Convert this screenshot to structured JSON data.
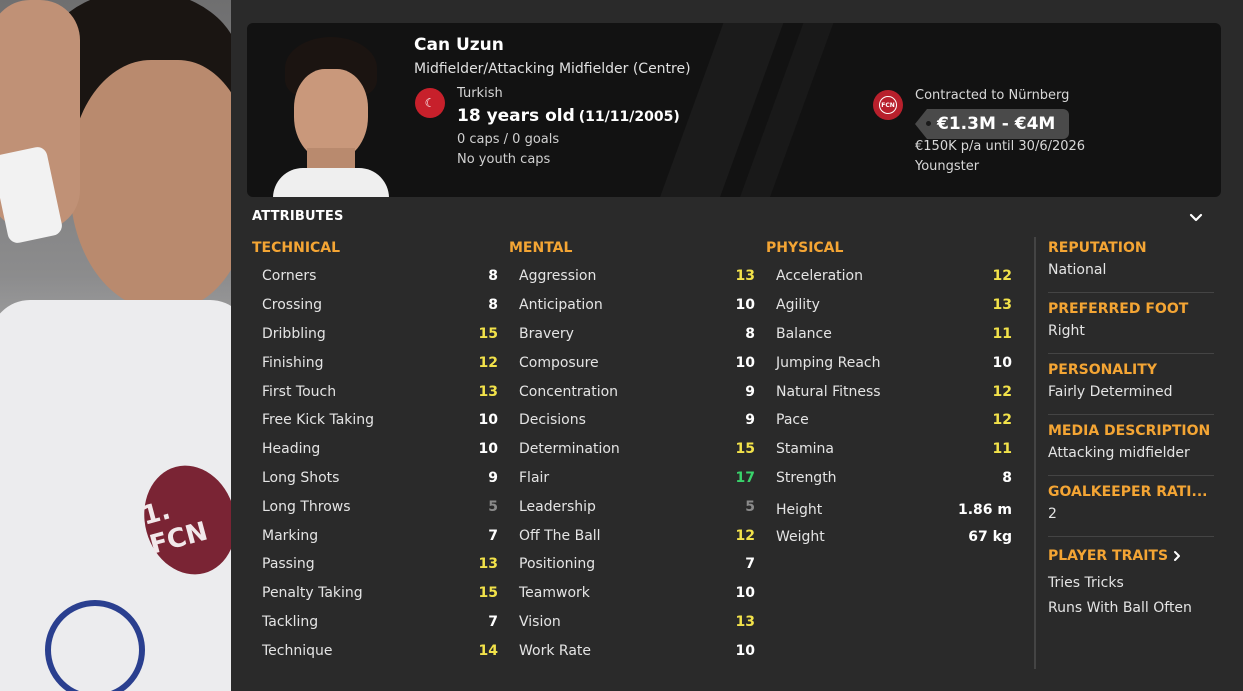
{
  "player": {
    "name": "Can Uzun",
    "position": "Midfielder/Attacking Midfielder (Centre)",
    "nationality": "Turkish",
    "age": "18 years old",
    "dob": "(11/11/2005)",
    "caps": "0 caps / 0 goals",
    "youth_caps": "No youth caps",
    "club_crest_text": "FCN",
    "contract": "Contracted to Nürnberg",
    "value": "€1.3M - €4M",
    "wage": "€150K p/a until 30/6/2026",
    "squad_status": "Youngster",
    "shirt_badge_text": "1. FCN"
  },
  "attributes": {
    "title": "ATTRIBUTES",
    "technical": {
      "heading": "TECHNICAL",
      "items": [
        {
          "label": "Corners",
          "value": "8"
        },
        {
          "label": "Crossing",
          "value": "8"
        },
        {
          "label": "Dribbling",
          "value": "15"
        },
        {
          "label": "Finishing",
          "value": "12"
        },
        {
          "label": "First Touch",
          "value": "13"
        },
        {
          "label": "Free Kick Taking",
          "value": "10"
        },
        {
          "label": "Heading",
          "value": "10"
        },
        {
          "label": "Long Shots",
          "value": "9"
        },
        {
          "label": "Long Throws",
          "value": "5"
        },
        {
          "label": "Marking",
          "value": "7"
        },
        {
          "label": "Passing",
          "value": "13"
        },
        {
          "label": "Penalty Taking",
          "value": "15"
        },
        {
          "label": "Tackling",
          "value": "7"
        },
        {
          "label": "Technique",
          "value": "14"
        }
      ]
    },
    "mental": {
      "heading": "MENTAL",
      "items": [
        {
          "label": "Aggression",
          "value": "13"
        },
        {
          "label": "Anticipation",
          "value": "10"
        },
        {
          "label": "Bravery",
          "value": "8"
        },
        {
          "label": "Composure",
          "value": "10"
        },
        {
          "label": "Concentration",
          "value": "9"
        },
        {
          "label": "Decisions",
          "value": "9"
        },
        {
          "label": "Determination",
          "value": "15"
        },
        {
          "label": "Flair",
          "value": "17"
        },
        {
          "label": "Leadership",
          "value": "5"
        },
        {
          "label": "Off The Ball",
          "value": "12"
        },
        {
          "label": "Positioning",
          "value": "7"
        },
        {
          "label": "Teamwork",
          "value": "10"
        },
        {
          "label": "Vision",
          "value": "13"
        },
        {
          "label": "Work Rate",
          "value": "10"
        }
      ]
    },
    "physical": {
      "heading": "PHYSICAL",
      "items": [
        {
          "label": "Acceleration",
          "value": "12"
        },
        {
          "label": "Agility",
          "value": "13"
        },
        {
          "label": "Balance",
          "value": "11"
        },
        {
          "label": "Jumping Reach",
          "value": "10"
        },
        {
          "label": "Natural Fitness",
          "value": "12"
        },
        {
          "label": "Pace",
          "value": "12"
        },
        {
          "label": "Stamina",
          "value": "11"
        },
        {
          "label": "Strength",
          "value": "8"
        }
      ],
      "height_label": "Height",
      "height_value": "1.86 m",
      "weight_label": "Weight",
      "weight_value": "67 kg"
    }
  },
  "info": {
    "reputation_h": "REPUTATION",
    "reputation_v": "National",
    "foot_h": "PREFERRED FOOT",
    "foot_v": "Right",
    "personality_h": "PERSONALITY",
    "personality_v": "Fairly Determined",
    "media_h": "MEDIA DESCRIPTION",
    "media_v": "Attacking midfielder",
    "gk_h": "GOALKEEPER RATI...",
    "gk_v": "2",
    "traits_h": "PLAYER TRAITS",
    "traits": [
      "Tries Tricks",
      "Runs With Ball Often"
    ]
  },
  "colors": {
    "accent": "#f4a534",
    "good": "#f2e24a",
    "excellent": "#39d36b",
    "poor": "#8a8a8a"
  }
}
